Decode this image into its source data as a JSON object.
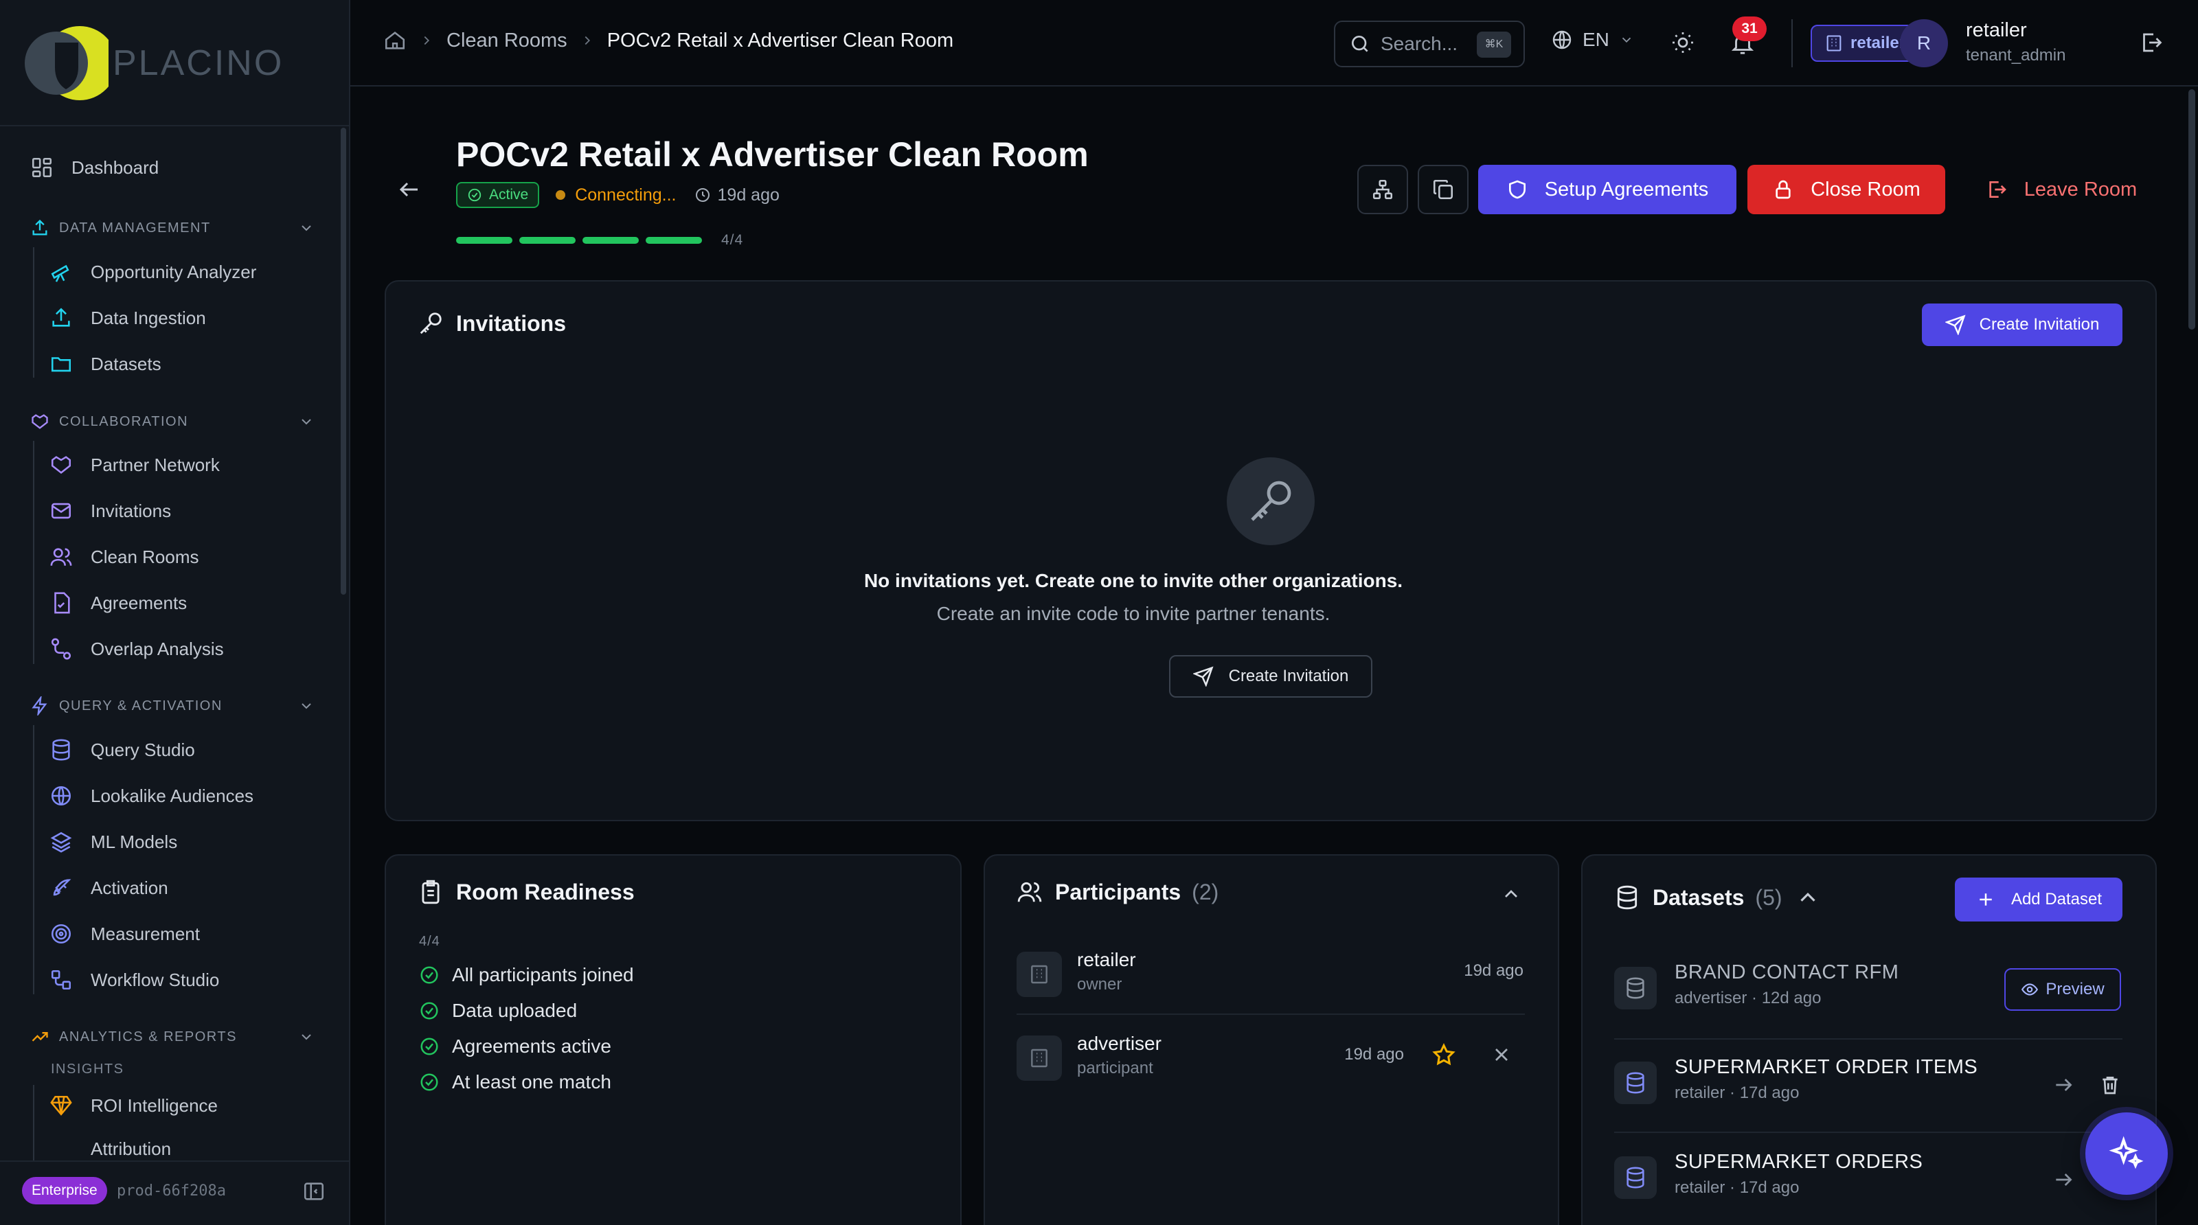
{
  "brand": {
    "name": "PLACINO"
  },
  "sidebar": {
    "dashboard": "Dashboard",
    "sections": {
      "data_management": "DATA MANAGEMENT",
      "collaboration": "COLLABORATION",
      "query_activation": "QUERY & ACTIVATION",
      "analytics_reports": "ANALYTICS & REPORTS"
    },
    "items": {
      "opportunity_analyzer": "Opportunity Analyzer",
      "data_ingestion": "Data Ingestion",
      "datasets": "Datasets",
      "partner_network": "Partner Network",
      "invitations": "Invitations",
      "clean_rooms": "Clean Rooms",
      "agreements": "Agreements",
      "overlap_analysis": "Overlap Analysis",
      "query_studio": "Query Studio",
      "lookalike_audiences": "Lookalike Audiences",
      "ml_models": "ML Models",
      "activation": "Activation",
      "measurement": "Measurement",
      "workflow_studio": "Workflow Studio",
      "roi_intelligence": "ROI Intelligence",
      "attribution": "Attribution"
    },
    "insights_label": "INSIGHTS",
    "footer": {
      "plan": "Enterprise",
      "build": "prod-66f208a"
    }
  },
  "topbar": {
    "breadcrumb": [
      "Clean Rooms",
      "POCv2 Retail x Advertiser Clean Room"
    ],
    "search_placeholder": "Search...",
    "search_shortcut": "⌘K",
    "language": "EN",
    "notifications": "31",
    "tenant": "retailer",
    "avatar_initial": "R",
    "user_name": "retailer",
    "user_role": "tenant_admin"
  },
  "room": {
    "title": "POCv2 Retail x Advertiser Clean Room",
    "status": "Active",
    "connection": "Connecting...",
    "created": "19d ago",
    "progress_done": 4,
    "progress_total": 4,
    "progress_label": "4/4",
    "actions": {
      "setup_agreements": "Setup Agreements",
      "close_room": "Close Room",
      "leave_room": "Leave Room"
    }
  },
  "invitations": {
    "title": "Invitations",
    "create_label": "Create Invitation",
    "empty_title": "No invitations yet. Create one to invite other organizations.",
    "empty_subtitle": "Create an invite code to invite partner tenants."
  },
  "readiness": {
    "title": "Room Readiness",
    "count": "4/4",
    "items": [
      "All participants joined",
      "Data uploaded",
      "Agreements active",
      "At least one match"
    ]
  },
  "participants": {
    "title": "Participants",
    "count": "(2)",
    "rows": [
      {
        "name": "retailer",
        "role": "owner",
        "time": "19d ago"
      },
      {
        "name": "advertiser",
        "role": "participant",
        "time": "19d ago"
      }
    ]
  },
  "datasets": {
    "title": "Datasets",
    "count": "(5)",
    "add_label": "Add Dataset",
    "preview_label": "Preview",
    "rows": [
      {
        "name": "BRAND CONTACT RFM",
        "meta": "advertiser · 12d ago"
      },
      {
        "name": "SUPERMARKET ORDER ITEMS",
        "meta": "retailer · 17d ago"
      },
      {
        "name": "SUPERMARKET ORDERS",
        "meta": "retailer · 17d ago"
      }
    ]
  },
  "colors": {
    "accent": "#4f46e5",
    "danger": "#dc2626",
    "success": "#22c55e",
    "warning": "#f59e0b",
    "brand_yellow": "#d9e021"
  }
}
